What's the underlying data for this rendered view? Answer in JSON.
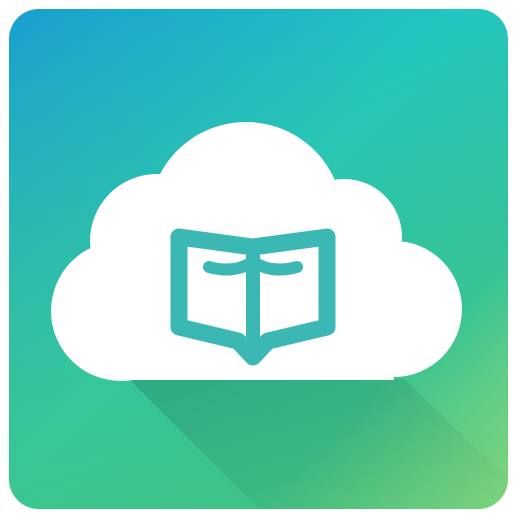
{
  "app_icon": {
    "icon": "cloud-book-icon",
    "colors": {
      "gradient_top_left": "#1a9fd0",
      "gradient_top_right": "#22c6c0",
      "gradient_mid": "#2cc2a8",
      "gradient_bottom_left": "#4fc56a",
      "gradient_bottom_right": "#b6e58e",
      "cloud": "#ffffff",
      "book": "#3bb8b3",
      "long_shadow": "#000000"
    }
  }
}
